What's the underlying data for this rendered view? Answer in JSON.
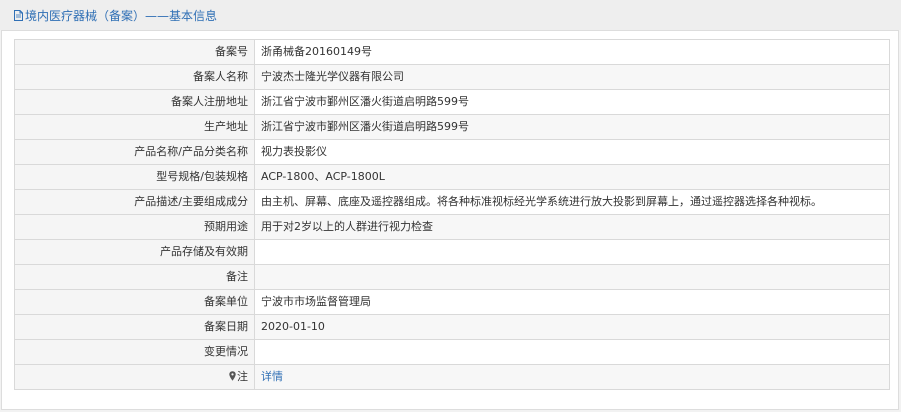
{
  "header": {
    "icon": "document-icon",
    "title": "境内医疗器械（备案）——基本信息",
    "accent_color": "#2f6fb5"
  },
  "rows": [
    {
      "label": "备案号",
      "value": "浙甬械备20160149号"
    },
    {
      "label": "备案人名称",
      "value": "宁波杰士隆光学仪器有限公司"
    },
    {
      "label": "备案人注册地址",
      "value": "浙江省宁波市鄞州区潘火街道启明路599号"
    },
    {
      "label": "生产地址",
      "value": "浙江省宁波市鄞州区潘火街道启明路599号"
    },
    {
      "label": "产品名称/产品分类名称",
      "value": "视力表投影仪"
    },
    {
      "label": "型号规格/包装规格",
      "value": "ACP-1800、ACP-1800L"
    },
    {
      "label": "产品描述/主要组成成分",
      "value": "由主机、屏幕、底座及遥控器组成。将各种标准视标经光学系统进行放大投影到屏幕上，通过遥控器选择各种视标。"
    },
    {
      "label": "预期用途",
      "value": "用于对2岁以上的人群进行视力检查"
    },
    {
      "label": "产品存储及有效期",
      "value": ""
    },
    {
      "label": "备注",
      "value": ""
    },
    {
      "label": "备案单位",
      "value": "宁波市市场监督管理局"
    },
    {
      "label": "备案日期",
      "value": "2020-01-10"
    },
    {
      "label": "变更情况",
      "value": ""
    }
  ],
  "note_row": {
    "icon": "location-pin-icon",
    "label": "注",
    "link_text": "详情"
  }
}
